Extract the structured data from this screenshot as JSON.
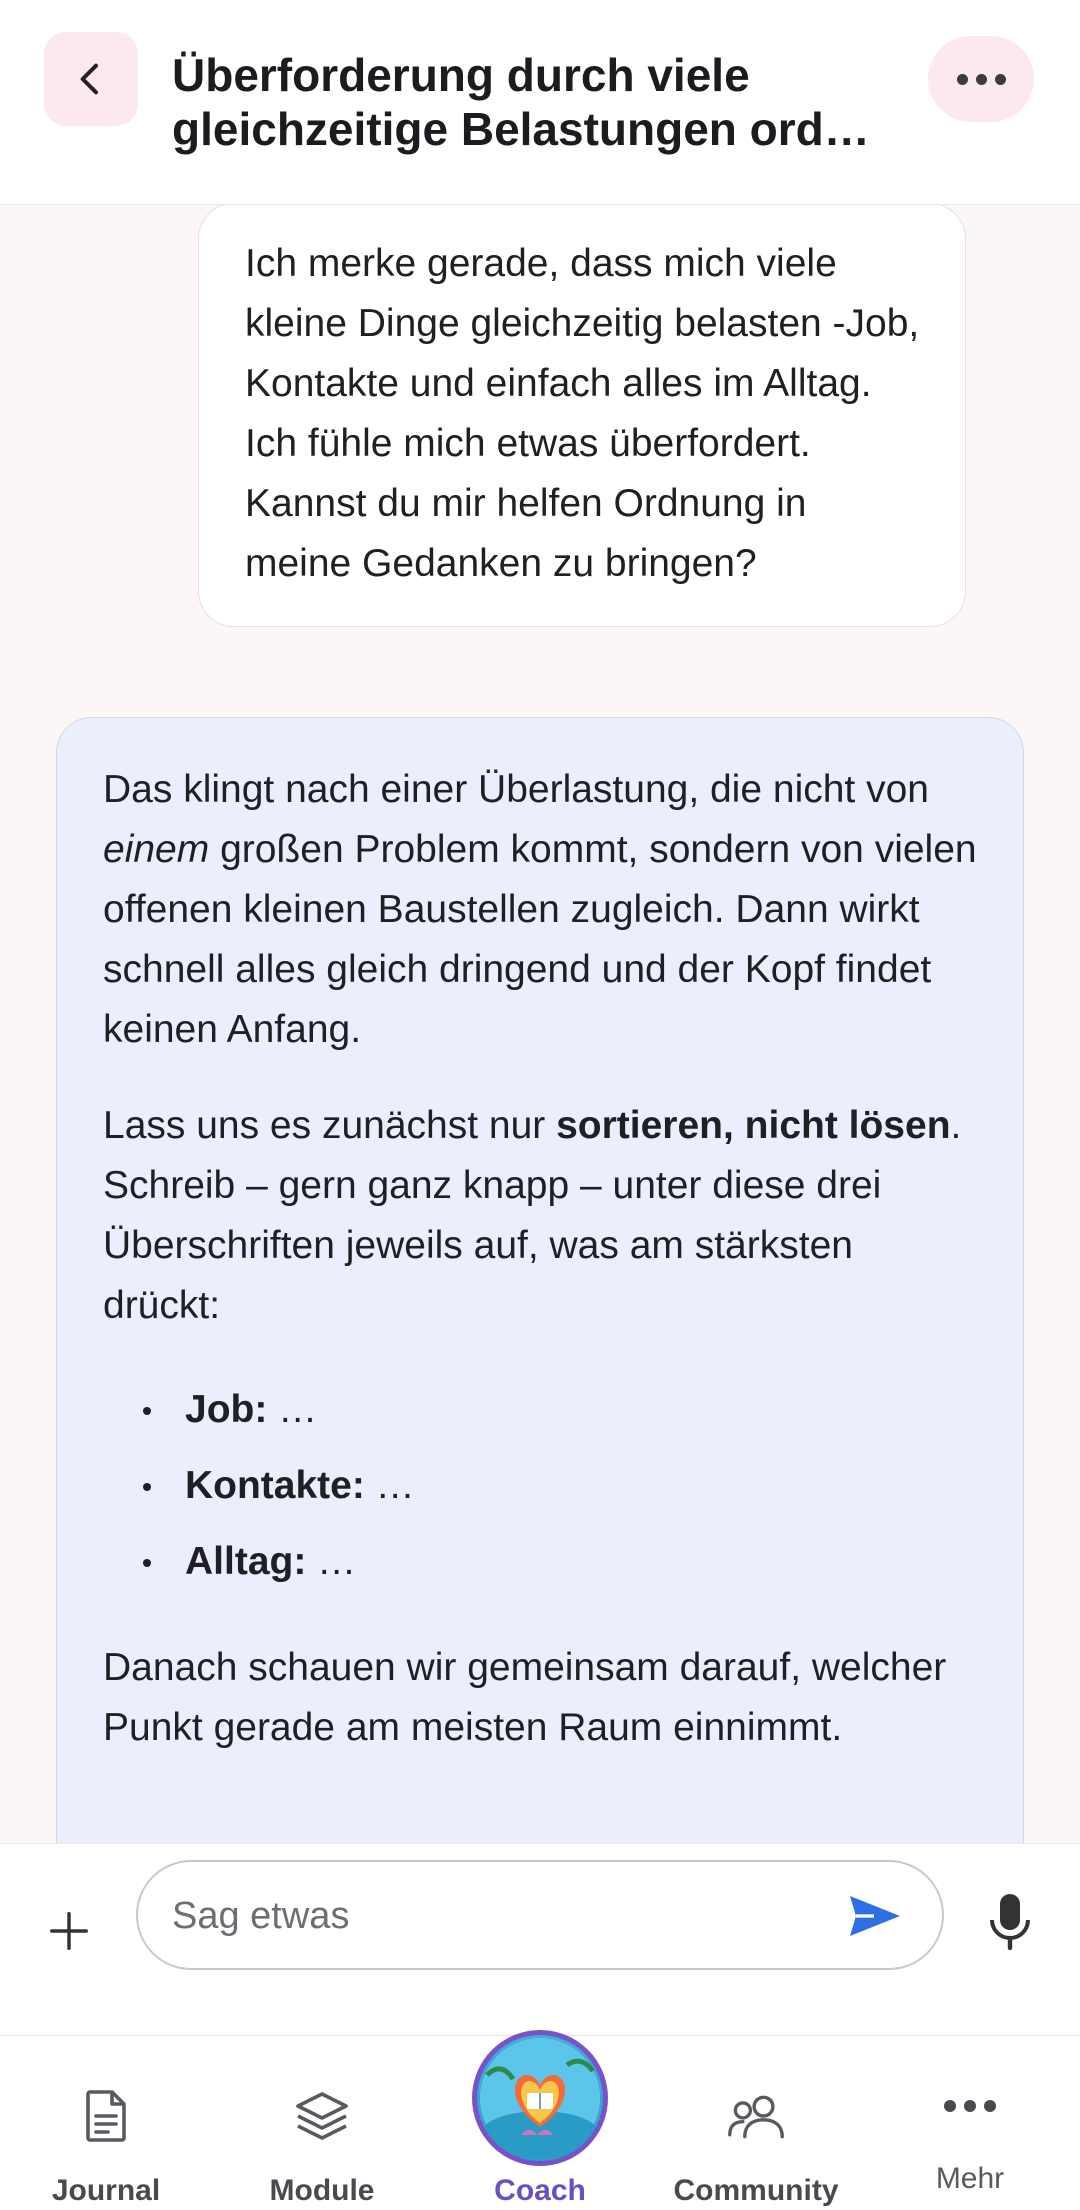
{
  "header": {
    "title_line1": "Überforderung durch viele",
    "title_line2": "gleichzeitige Belastungen ord…"
  },
  "messages": {
    "user": "Ich merke gerade, dass mich viele kleine Dinge gleichzeitig belasten -Job, Kontakte und einfach alles im Alltag. Ich fühle mich etwas überfordert. Kannst du mir helfen Ordnung in meine Gedanken zu bringen?",
    "bot": {
      "p1_a": "Das klingt nach einer Überlastung, die nicht von ",
      "p1_em": "einem",
      "p1_b": " großen Problem kommt, sondern von vielen offenen kleinen Baustellen zugleich. Dann wirkt schnell alles gleich dringend und der Kopf findet keinen Anfang.",
      "p2_a": "Lass uns es zunächst nur ",
      "p2_bold": "sortieren, nicht lösen",
      "p2_b": ". Schreib – gern ganz knapp – unter diese drei Überschriften jeweils auf, was am stärksten drückt:",
      "bullets": [
        {
          "label": "Job:",
          "rest": " …"
        },
        {
          "label": "Kontakte:",
          "rest": " …"
        },
        {
          "label": "Alltag:",
          "rest": " …"
        }
      ],
      "p3": "Danach schauen wir gemeinsam darauf, welcher Punkt gerade am meisten Raum einnimmt."
    }
  },
  "composer": {
    "placeholder": "Sag etwas"
  },
  "nav": {
    "items": [
      {
        "label": "Journal",
        "icon": "document-icon"
      },
      {
        "label": "Module",
        "icon": "layers-icon"
      },
      {
        "label": "Coach",
        "icon": "coach-avatar"
      },
      {
        "label": "Community",
        "icon": "people-icon"
      },
      {
        "label": "Mehr",
        "icon": "more-dots-icon"
      }
    ],
    "active": "Coach"
  },
  "colors": {
    "accent": "#6a4fc4",
    "send": "#2f6fe4",
    "user_bubble": "#ffffff",
    "bot_bubble": "#ebeefb",
    "header_button": "#fce9ee"
  }
}
